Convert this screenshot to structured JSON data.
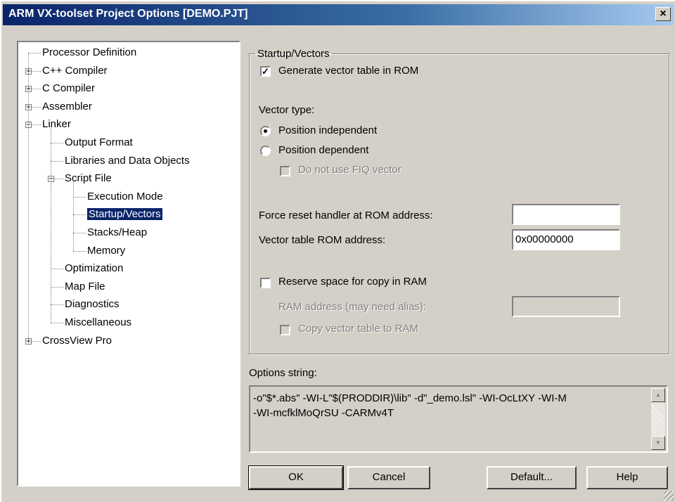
{
  "window": {
    "title": "ARM VX-toolset Project Options [DEMO.PJT]",
    "close_glyph": "×"
  },
  "tree": {
    "items": [
      {
        "label": "Processor Definition",
        "level": 0,
        "expander": ""
      },
      {
        "label": "C++ Compiler",
        "level": 0,
        "expander": "+"
      },
      {
        "label": "C Compiler",
        "level": 0,
        "expander": "+"
      },
      {
        "label": "Assembler",
        "level": 0,
        "expander": "+"
      },
      {
        "label": "Linker",
        "level": 0,
        "expander": "−"
      },
      {
        "label": "Output Format",
        "level": 1,
        "expander": ""
      },
      {
        "label": "Libraries and Data Objects",
        "level": 1,
        "expander": ""
      },
      {
        "label": "Script File",
        "level": 1,
        "expander": "−"
      },
      {
        "label": "Execution Mode",
        "level": 2,
        "expander": ""
      },
      {
        "label": "Startup/Vectors",
        "level": 2,
        "expander": "",
        "selected": true
      },
      {
        "label": "Stacks/Heap",
        "level": 2,
        "expander": ""
      },
      {
        "label": "Memory",
        "level": 2,
        "expander": ""
      },
      {
        "label": "Optimization",
        "level": 1,
        "expander": ""
      },
      {
        "label": "Map File",
        "level": 1,
        "expander": ""
      },
      {
        "label": "Diagnostics",
        "level": 1,
        "expander": ""
      },
      {
        "label": "Miscellaneous",
        "level": 1,
        "expander": ""
      },
      {
        "label": "CrossView Pro",
        "level": 0,
        "expander": "+"
      }
    ]
  },
  "panel": {
    "group_title": "Startup/Vectors",
    "gen_vector_label": "Generate vector table in ROM",
    "gen_vector_checked": true,
    "vector_type_label": "Vector type:",
    "pos_indep_label": "Position independent",
    "pos_dep_label": "Position dependent",
    "vector_type_selected": "Position independent",
    "no_fiq_label": "Do not use FIQ vector",
    "force_reset_label": "Force reset handler at ROM address:",
    "force_reset_value": "",
    "vector_rom_label": "Vector table ROM address:",
    "vector_rom_value": "0x00000000",
    "reserve_label": "Reserve space for copy in RAM",
    "reserve_checked": false,
    "ram_addr_label": "RAM address (may need alias):",
    "ram_addr_value": "",
    "copy_ram_label": "Copy vector table to RAM"
  },
  "options": {
    "label": "Options string:",
    "line1": "-o\"$*.abs\" -WI-L\"$(PRODDIR)\\lib\" -d\"_demo.lsl\" -WI-OcLtXY -WI-M",
    "line2": "-WI-mcfklMoQrSU -CARMv4T"
  },
  "buttons": {
    "ok": "OK",
    "cancel": "Cancel",
    "default": "Default...",
    "help": "Help"
  },
  "icons": {
    "check": "✓",
    "scroll_up": "▲",
    "scroll_down": "▼"
  }
}
